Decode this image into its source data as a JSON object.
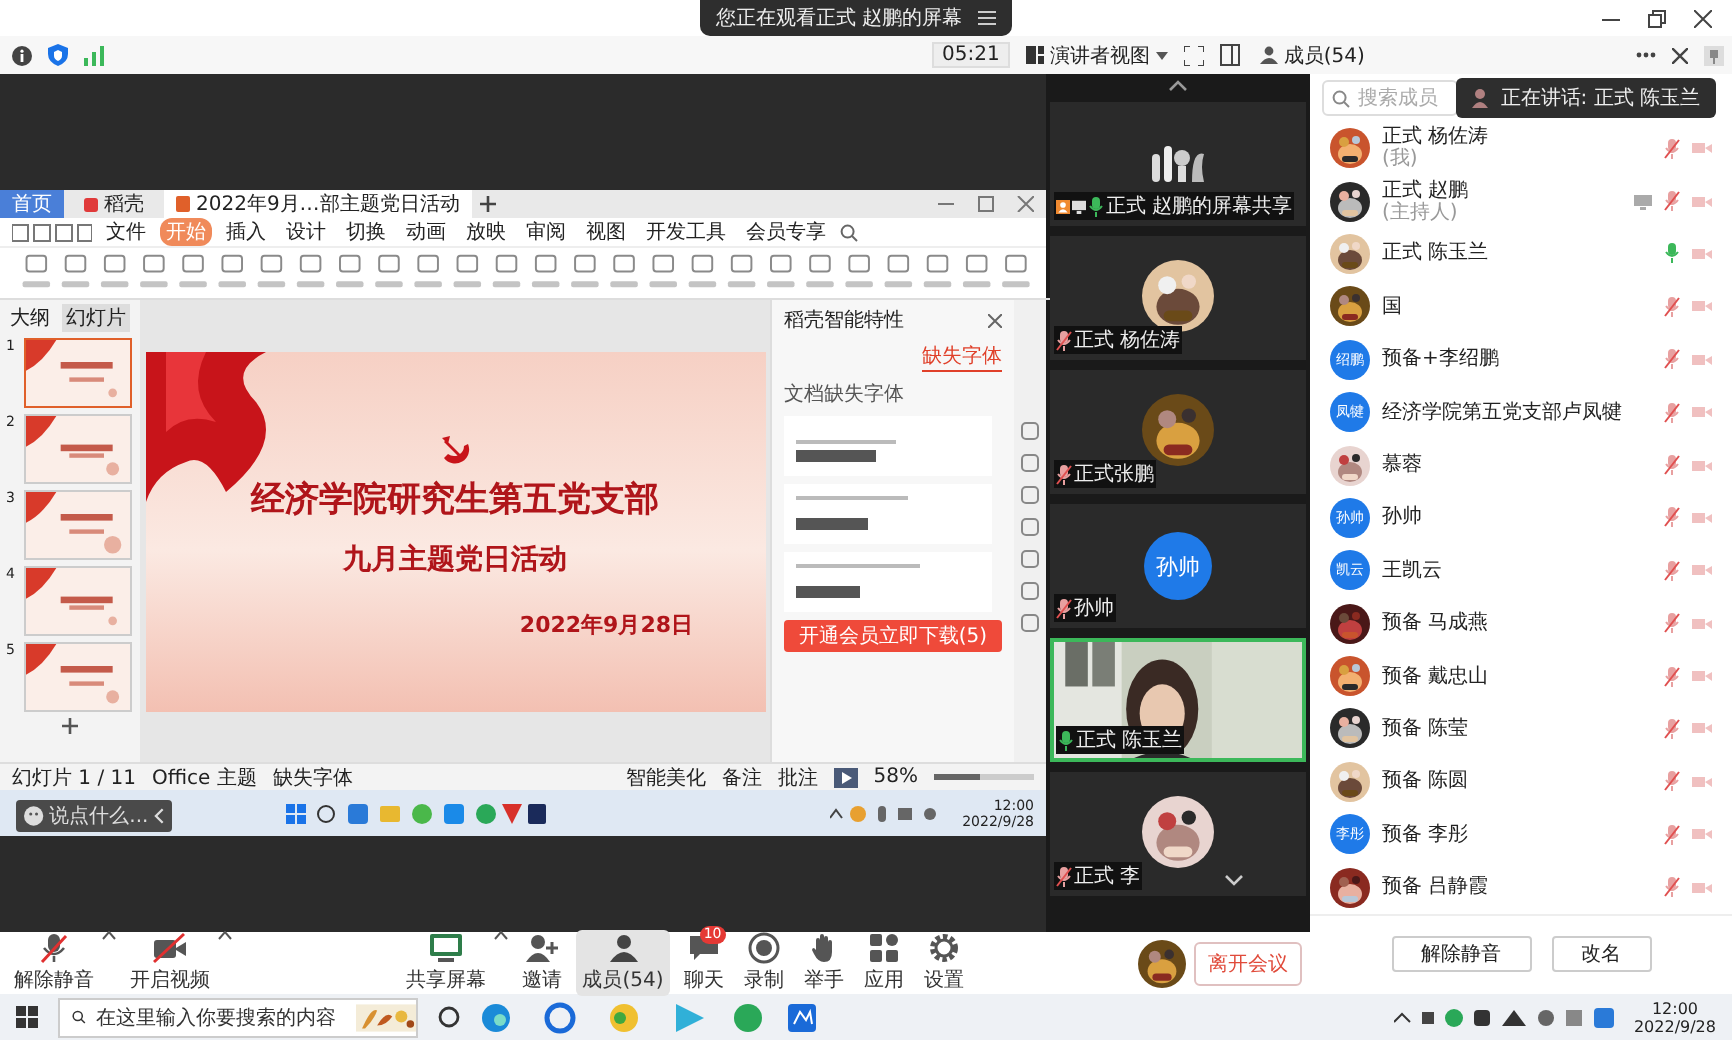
{
  "title_bar": {
    "notice": "您正在观看正式 赵鹏的屏幕"
  },
  "toolbar": {
    "timer": "05:21",
    "view": "演讲者视图",
    "members_tab": "成员(54)"
  },
  "shared_screen": {
    "tabs": [
      {
        "label": "首页",
        "kind": "home",
        "selected": false
      },
      {
        "label": "稻壳",
        "kind": "app",
        "selected": false
      },
      {
        "label": "2022年9月…部主题党日活动",
        "kind": "doc",
        "selected": true
      }
    ],
    "menu": [
      {
        "label": "文件",
        "selected": false
      },
      {
        "label": "开始",
        "selected": true
      },
      {
        "label": "插入",
        "selected": false
      },
      {
        "label": "设计",
        "selected": false
      },
      {
        "label": "切换",
        "selected": false
      },
      {
        "label": "动画",
        "selected": false
      },
      {
        "label": "放映",
        "selected": false
      },
      {
        "label": "审阅",
        "selected": false
      },
      {
        "label": "视图",
        "selected": false
      },
      {
        "label": "开发工具",
        "selected": false
      },
      {
        "label": "会员专享",
        "selected": false
      }
    ],
    "panel_tabs": [
      {
        "label": "大纲",
        "selected": false
      },
      {
        "label": "幻灯片",
        "selected": true
      }
    ],
    "thumbnails": [
      {
        "number": "1",
        "selected": true
      },
      {
        "number": "2",
        "selected": false
      },
      {
        "number": "3",
        "selected": false
      },
      {
        "number": "4",
        "selected": false
      },
      {
        "number": "5",
        "selected": false
      }
    ],
    "slide": {
      "title": "经济学院研究生第五党支部",
      "subtitle": "九月主题党日活动",
      "date": "2022年9月28日"
    },
    "pane": {
      "title": "稻壳智能特性",
      "tabs": [
        {
          "label": "缺失字体",
          "selected": true
        }
      ],
      "section": "文档缺失字体",
      "download_button": "开通会员立即下载(5)"
    },
    "status": {
      "slide": "幻灯片 1 / 11",
      "theme": "Office 主题",
      "font": "缺失字体",
      "beautify": "智能美化",
      "notes": "备注",
      "comments": "批注",
      "zoom": "58%",
      "zoom_level": {
        "level": 0.45
      }
    },
    "inner_taskbar": {
      "time": "12:00",
      "date": "2022/9/28"
    },
    "chat_input": {
      "placeholder": "说点什么..."
    }
  },
  "videos": [
    {
      "name": "正式 赵鹏的屏幕共享",
      "kind": "logo",
      "sharing": true,
      "muted": false,
      "speaking": false
    },
    {
      "name": "正式 杨佐涛",
      "kind": "avatar",
      "sharing": false,
      "muted": true,
      "speaking": false
    },
    {
      "name": "正式张鹏",
      "kind": "avatar",
      "sharing": false,
      "muted": true,
      "speaking": false
    },
    {
      "name": "孙帅",
      "kind": "initials",
      "initials": "孙帅",
      "sharing": false,
      "muted": true,
      "speaking": false
    },
    {
      "name": "正式 陈玉兰",
      "kind": "camera",
      "sharing": false,
      "muted": false,
      "speaking": true
    },
    {
      "name": "正式 李",
      "kind": "avatar",
      "sharing": false,
      "muted": true,
      "speaking": false
    }
  ],
  "members": {
    "search": {
      "placeholder": "搜索成员"
    },
    "speaking": "正在讲话: 正式 陈玉兰",
    "items": [
      {
        "name": "正式 杨佐涛",
        "note": "(我)",
        "kind": "picture",
        "muted": true,
        "sharing": false
      },
      {
        "name": "正式 赵鹏",
        "note": "(主持人)",
        "kind": "picture",
        "muted": true,
        "sharing": true
      },
      {
        "name": "正式 陈玉兰",
        "kind": "picture",
        "muted": false,
        "sharing": false
      },
      {
        "name": "国",
        "kind": "picture",
        "muted": true,
        "sharing": false
      },
      {
        "name": "预备+李绍鹏",
        "kind": "initials",
        "initials": "绍鹏",
        "muted": true,
        "sharing": false
      },
      {
        "name": "经济学院第五党支部卢凤犍",
        "kind": "initials",
        "initials": "凤犍",
        "muted": true,
        "sharing": false
      },
      {
        "name": "慕蓉",
        "kind": "picture",
        "muted": true,
        "sharing": false
      },
      {
        "name": "孙帅",
        "kind": "initials",
        "initials": "孙帅",
        "muted": true,
        "sharing": false
      },
      {
        "name": "王凯云",
        "kind": "initials",
        "initials": "凯云",
        "muted": true,
        "sharing": false
      },
      {
        "name": "预备 马成燕",
        "kind": "picture",
        "muted": true,
        "sharing": false
      },
      {
        "name": "预备 戴忠山",
        "kind": "picture",
        "muted": true,
        "sharing": false
      },
      {
        "name": "预备 陈莹",
        "kind": "picture",
        "muted": true,
        "sharing": false
      },
      {
        "name": "预备 陈圆",
        "kind": "picture",
        "muted": true,
        "sharing": false
      },
      {
        "name": "预备 李彤",
        "kind": "initials",
        "initials": "李彤",
        "muted": true,
        "sharing": false
      },
      {
        "name": "预备 吕静霞",
        "kind": "picture",
        "muted": true,
        "sharing": false
      }
    ],
    "buttons": [
      "解除静音",
      "改名"
    ]
  },
  "meeting_toolbar": {
    "left": [
      {
        "label": "解除静音",
        "kind": "mic-off",
        "has_menu": true,
        "selected": false
      },
      {
        "label": "开启视频",
        "kind": "video-off",
        "has_menu": true,
        "selected": false
      }
    ],
    "center": [
      {
        "label": "共享屏幕",
        "kind": "share",
        "has_menu": true,
        "selected": false
      },
      {
        "label": "邀请",
        "kind": "invite",
        "has_menu": false,
        "selected": false
      },
      {
        "label": "成员(54)",
        "kind": "members",
        "has_menu": false,
        "selected": true
      },
      {
        "label": "聊天",
        "kind": "chat",
        "badge": "10",
        "has_menu": false,
        "selected": false
      },
      {
        "label": "录制",
        "kind": "record",
        "has_menu": false,
        "selected": false
      },
      {
        "label": "举手",
        "kind": "hand",
        "has_menu": false,
        "selected": false
      },
      {
        "label": "应用",
        "kind": "apps",
        "has_menu": false,
        "selected": false
      },
      {
        "label": "设置",
        "kind": "settings",
        "has_menu": false,
        "selected": false
      }
    ],
    "leave_button": "离开会议"
  },
  "taskbar": {
    "search": {
      "placeholder": "在这里输入你要搜索的内容"
    },
    "time": "12:00",
    "date": "2022/9/28"
  }
}
